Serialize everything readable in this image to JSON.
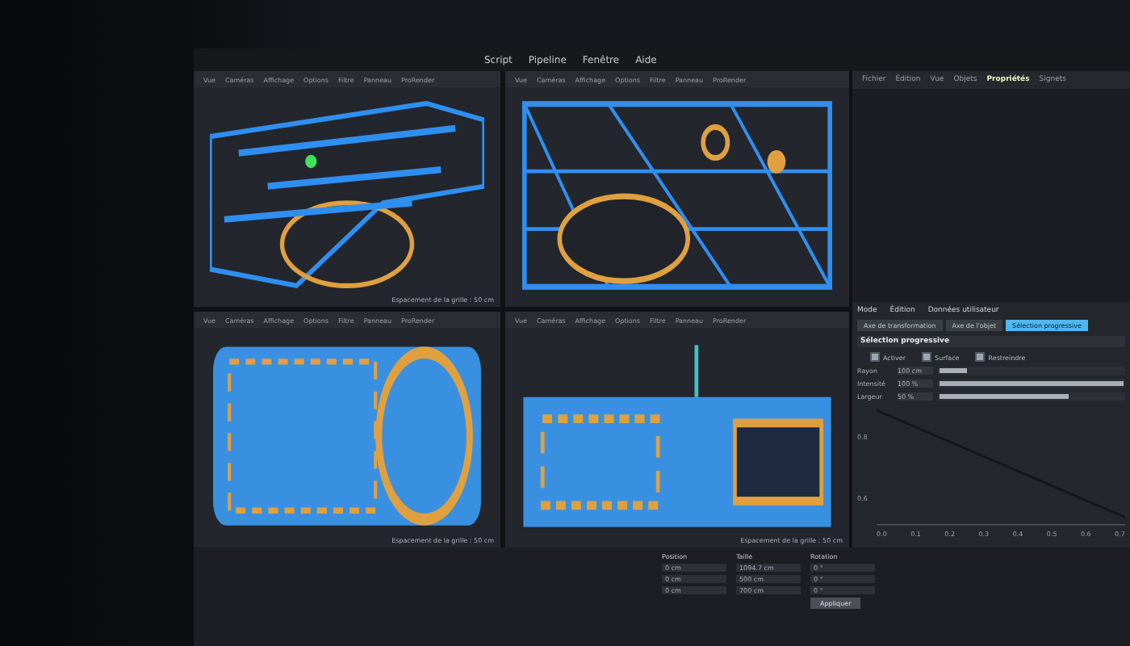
{
  "menu_bar": {
    "items": [
      "Script",
      "Pipeline",
      "Fenêtre",
      "Aide"
    ]
  },
  "viewports": [
    {
      "tabs": [
        "Vue",
        "Caméras",
        "Affichage",
        "Options",
        "Filtre",
        "Panneau",
        "ProRender"
      ],
      "grid_label": "Espacement de la grille : 50 cm",
      "kind": "perspective"
    },
    {
      "tabs": [
        "Vue",
        "Caméras",
        "Affichage",
        "Options",
        "Filtre",
        "Panneau",
        "ProRender"
      ],
      "kind": "side"
    },
    {
      "tabs": [
        "Vue",
        "Caméras",
        "Affichage",
        "Options",
        "Filtre",
        "Panneau",
        "ProRender"
      ],
      "grid_label": "Espacement de la grille : 50 cm",
      "kind": "top"
    },
    {
      "tabs": [
        "Vue",
        "Caméras",
        "Affichage",
        "Options",
        "Filtre",
        "Panneau",
        "ProRender"
      ],
      "grid_label": "Espacement de la grille : 50 cm",
      "kind": "front"
    }
  ],
  "object_manager": {
    "tabs": [
      {
        "label": "Fichier",
        "selected": false
      },
      {
        "label": "Édition",
        "selected": false
      },
      {
        "label": "Vue",
        "selected": false
      },
      {
        "label": "Objets",
        "selected": false
      },
      {
        "label": "Propriétés",
        "selected": true
      },
      {
        "label": "Signets",
        "selected": false
      }
    ]
  },
  "attributes": {
    "tabs": [
      "Mode",
      "Édition",
      "Données utilisateur"
    ],
    "mode_buttons": [
      {
        "label": "Axe de transformation",
        "selected": false
      },
      {
        "label": "Axe de l'objet",
        "selected": false
      },
      {
        "label": "Sélection progressive",
        "selected": true
      }
    ],
    "section": "Sélection progressive",
    "checks": [
      {
        "label": "Activer",
        "checked": true
      },
      {
        "label": "Surface",
        "checked": true
      },
      {
        "label": "Restreindre",
        "checked": true
      }
    ],
    "sliders": [
      {
        "label": "Rayon",
        "value": "100 cm",
        "level": 0.15
      },
      {
        "label": "Intensité",
        "value": "100 %",
        "level": 1
      },
      {
        "label": "Largeur",
        "value": "50 %",
        "level": 0.7
      }
    ],
    "curve": {
      "y_ticks": [
        "0.8",
        "0.6"
      ],
      "x_ticks": [
        "0.0",
        "0.1",
        "0.2",
        "0.3",
        "0.4",
        "0.5",
        "0.6",
        "0.7"
      ]
    }
  },
  "coordinates": {
    "headers": [
      "Position",
      "Taille",
      "Rotation"
    ],
    "rows": [
      [
        "0 cm",
        "1094.7 cm",
        "0 °"
      ],
      [
        "0 cm",
        "500 cm",
        "0 °"
      ],
      [
        "0 cm",
        "700 cm",
        "0 °"
      ]
    ],
    "apply": "Appliquer"
  }
}
